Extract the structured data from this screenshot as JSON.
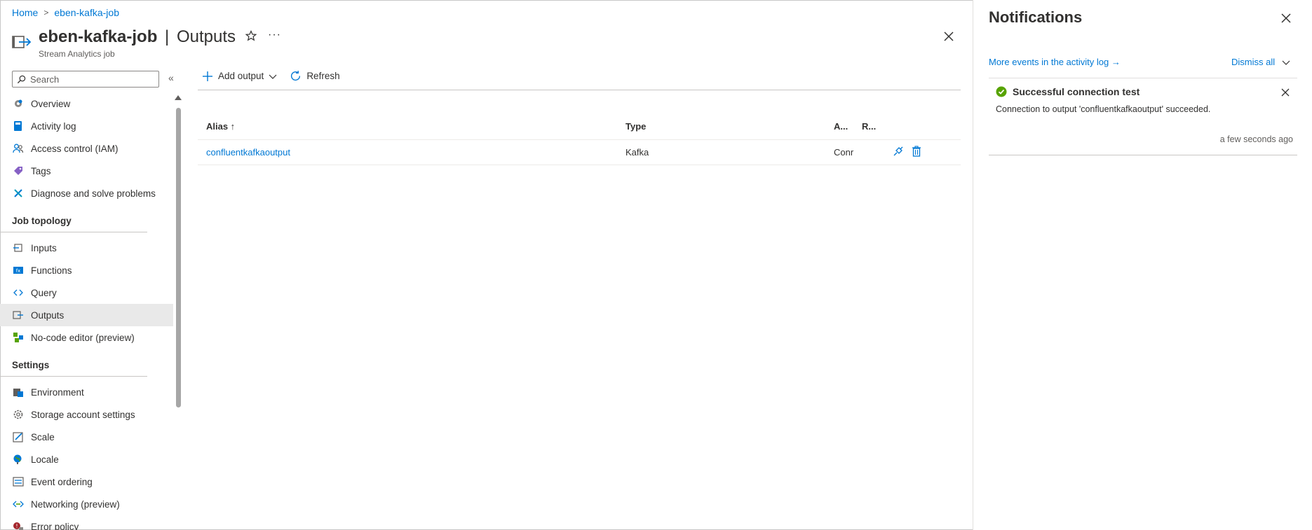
{
  "breadcrumb": {
    "home": "Home",
    "current": "eben-kafka-job"
  },
  "header": {
    "resource_name": "eben-kafka-job",
    "separator": "|",
    "page_name": "Outputs",
    "subtitle": "Stream Analytics job",
    "star_icon": "star-icon",
    "more_label": "···"
  },
  "sidebar": {
    "search_placeholder": "Search",
    "collapse_label": "«",
    "top_items": [
      {
        "label": "Overview",
        "icon": "gear-icon"
      },
      {
        "label": "Activity log",
        "icon": "book-icon"
      },
      {
        "label": "Access control (IAM)",
        "icon": "people-icon"
      },
      {
        "label": "Tags",
        "icon": "tag-icon"
      },
      {
        "label": "Diagnose and solve problems",
        "icon": "wrench-icon"
      }
    ],
    "section_job_topology": "Job topology",
    "topology_items": [
      {
        "label": "Inputs",
        "icon": "input-icon"
      },
      {
        "label": "Functions",
        "icon": "function-icon"
      },
      {
        "label": "Query",
        "icon": "code-icon"
      },
      {
        "label": "Outputs",
        "icon": "output-icon",
        "active": true
      },
      {
        "label": "No-code editor (preview)",
        "icon": "nocode-icon"
      }
    ],
    "section_settings": "Settings",
    "settings_items": [
      {
        "label": "Environment",
        "icon": "environment-icon"
      },
      {
        "label": "Storage account settings",
        "icon": "gear-icon"
      },
      {
        "label": "Scale",
        "icon": "scale-icon"
      },
      {
        "label": "Locale",
        "icon": "globe-icon"
      },
      {
        "label": "Event ordering",
        "icon": "ordering-icon"
      },
      {
        "label": "Networking (preview)",
        "icon": "network-icon"
      },
      {
        "label": "Error policy",
        "icon": "error-icon"
      }
    ]
  },
  "toolbar": {
    "add_output": "Add output",
    "refresh": "Refresh"
  },
  "table": {
    "headers": {
      "alias": "Alias ↑",
      "type": "Type",
      "a": "A...",
      "r": "R..."
    },
    "rows": [
      {
        "alias": "confluentkafkaoutput",
        "type": "Kafka",
        "a": "Conr"
      }
    ]
  },
  "notifications": {
    "title": "Notifications",
    "activity_link": "More events in the activity log →",
    "dismiss_all": "Dismiss all",
    "items": [
      {
        "title": "Successful connection test",
        "message": "Connection to output 'confluentkafkaoutput' succeeded.",
        "time": "a few seconds ago",
        "status_color": "#57a300"
      }
    ]
  },
  "colors": {
    "accent": "#0078d4",
    "success": "#57a300",
    "active_bg": "#e9e9e9"
  }
}
